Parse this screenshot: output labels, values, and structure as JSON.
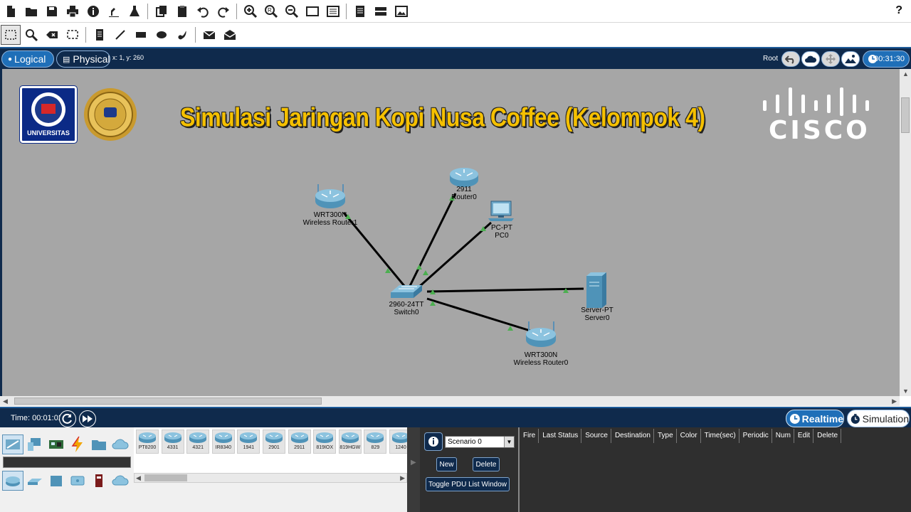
{
  "mode_bar": {
    "tab_logical": "Logical",
    "tab_physical": "Physical",
    "coords": "x: 1, y: 260",
    "root_label": "Root",
    "clock": "00:31:30"
  },
  "canvas": {
    "title": "Simulasi Jaringan Kopi Nusa Coffee (Kelompok 4)",
    "cisco_word": "CISCO",
    "university_label": "UNIVERSITAS",
    "devices": [
      {
        "model": "WRT300N",
        "name": "Wireless Router1"
      },
      {
        "model": "2911",
        "name": "Router0"
      },
      {
        "model": "PC-PT",
        "name": "PC0"
      },
      {
        "model": "2960-24TT",
        "name": "Switch0"
      },
      {
        "model": "Server-PT",
        "name": "Server0"
      },
      {
        "model": "WRT300N",
        "name": "Wireless Router0"
      }
    ]
  },
  "time_bar": {
    "time": "Time: 00:01:02",
    "realtime": "Realtime",
    "simulation": "Simulation"
  },
  "device_list": [
    "PT8200",
    "4331",
    "4321",
    "IR8340",
    "1941",
    "2901",
    "2911",
    "819IOX",
    "819HGW",
    "829",
    "1240"
  ],
  "scenario": {
    "selected": "Scenario 0",
    "new_label": "New",
    "delete_label": "Delete",
    "toggle_label": "Toggle PDU List Window"
  },
  "pdu_columns": [
    "Fire",
    "Last Status",
    "Source",
    "Destination",
    "Type",
    "Color",
    "Time(sec)",
    "Periodic",
    "Num",
    "Edit",
    "Delete"
  ],
  "colors": {
    "navy": "#0f2a4c",
    "accent": "#1f6fb8",
    "title_yellow": "#f5c000",
    "link_green": "#4caf50"
  }
}
